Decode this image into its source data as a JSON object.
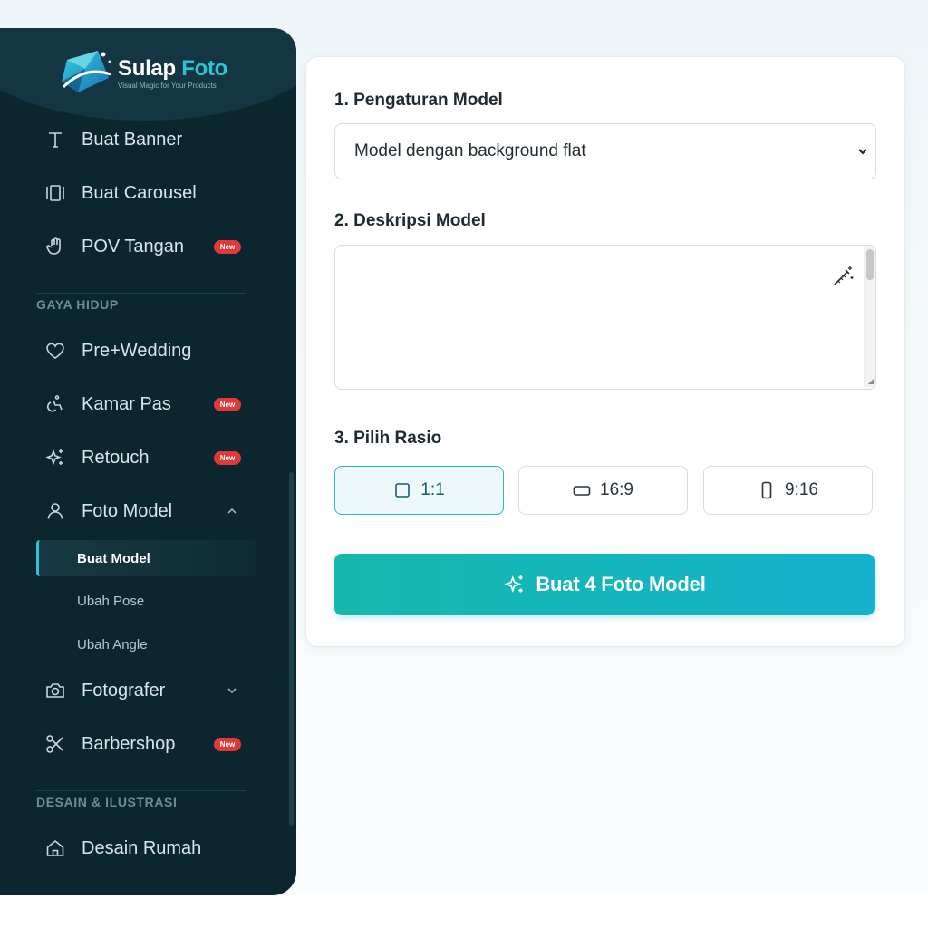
{
  "app": {
    "name_part1": "Sulap",
    "name_part2": "Foto",
    "tagline": "Visual Magic for Your Products"
  },
  "sidebar": {
    "items_top": [
      {
        "label": "Buat Banner",
        "icon": "text-icon"
      },
      {
        "label": "Buat Carousel",
        "icon": "carousel-icon"
      },
      {
        "label": "POV Tangan",
        "icon": "hand-icon",
        "badge": "New"
      }
    ],
    "section_lifestyle": "GAYA HIDUP",
    "items_lifestyle": [
      {
        "label": "Pre+Wedding",
        "icon": "heart-icon"
      },
      {
        "label": "Kamar Pas",
        "icon": "accessibility-icon",
        "badge": "New"
      },
      {
        "label": "Retouch",
        "icon": "sparkles-icon",
        "badge": "New"
      },
      {
        "label": "Foto Model",
        "icon": "user-icon",
        "expanded": true
      }
    ],
    "submenu": [
      {
        "label": "Buat Model",
        "active": true
      },
      {
        "label": "Ubah Pose"
      },
      {
        "label": "Ubah Angle"
      }
    ],
    "items_more": [
      {
        "label": "Fotografer",
        "icon": "camera-icon"
      },
      {
        "label": "Barbershop",
        "icon": "scissors-icon",
        "badge": "New"
      }
    ],
    "section_design": "DESAIN & ILUSTRASI",
    "items_design": [
      {
        "label": "Desain Rumah",
        "icon": "home-icon"
      }
    ]
  },
  "form": {
    "step1_label": "1. Pengaturan Model",
    "select_value": "Model dengan background flat",
    "step2_label": "2. Deskripsi Model",
    "description_value": "",
    "step3_label": "3. Pilih Rasio",
    "ratios": [
      {
        "label": "1:1",
        "selected": true
      },
      {
        "label": "16:9"
      },
      {
        "label": "9:16"
      }
    ],
    "generate_label": "Buat 4 Foto Model"
  },
  "colors": {
    "sidebar_bg": "#0c2630",
    "accent": "#2fc3d2",
    "badge": "#e0393a",
    "button_gradient_start": "#16b8ad",
    "button_gradient_end": "#14b2cc"
  }
}
